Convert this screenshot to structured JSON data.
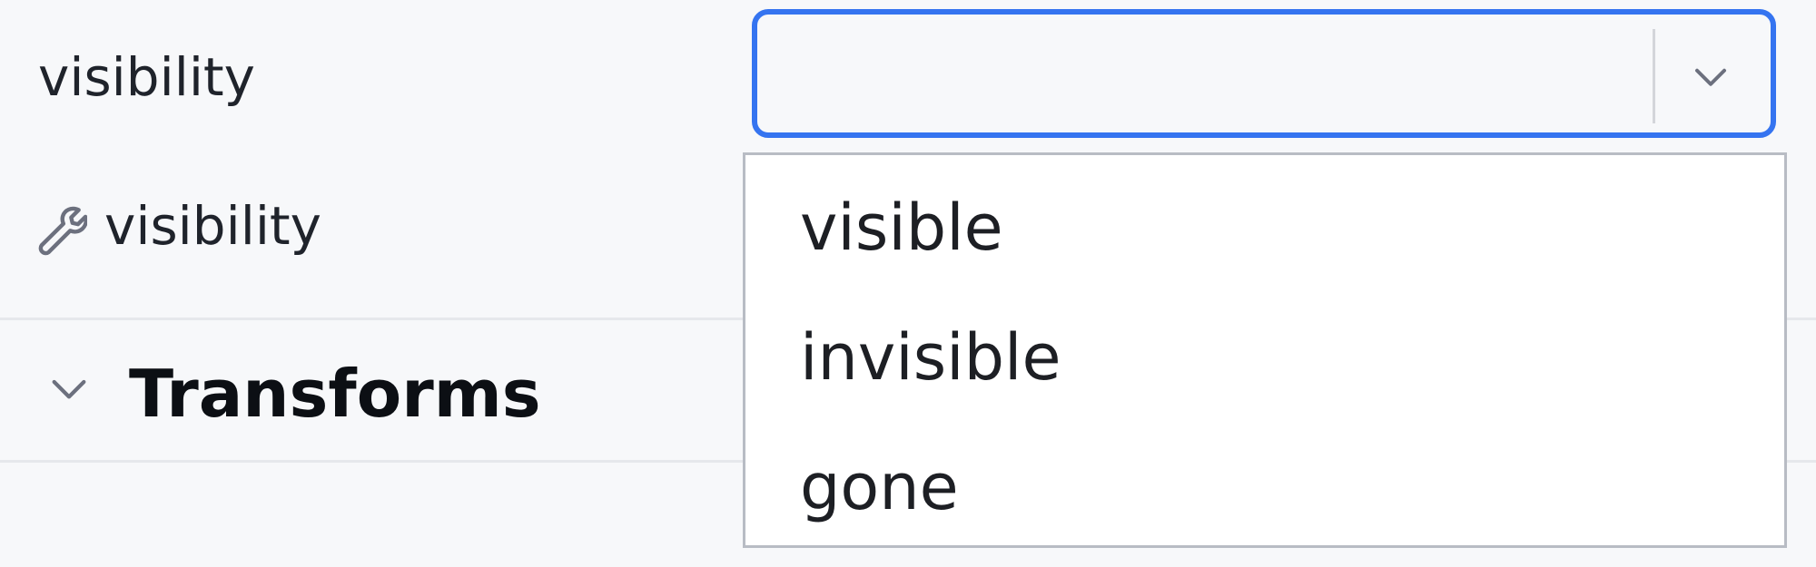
{
  "attributes": {
    "visibility_label": "visibility",
    "tools_visibility_label": "visibility",
    "tools_visibility_icon": "wrench-icon"
  },
  "section": {
    "title": "Transforms",
    "chevron_icon": "chevron-down-icon"
  },
  "visibility_select": {
    "value": "",
    "arrow_icon": "chevron-down-icon",
    "options": [
      "visible",
      "invisible",
      "gone"
    ]
  },
  "colors": {
    "focus_border": "#3574f0",
    "background": "#f7f8fa",
    "dropdown_border": "#b8bcc4"
  }
}
